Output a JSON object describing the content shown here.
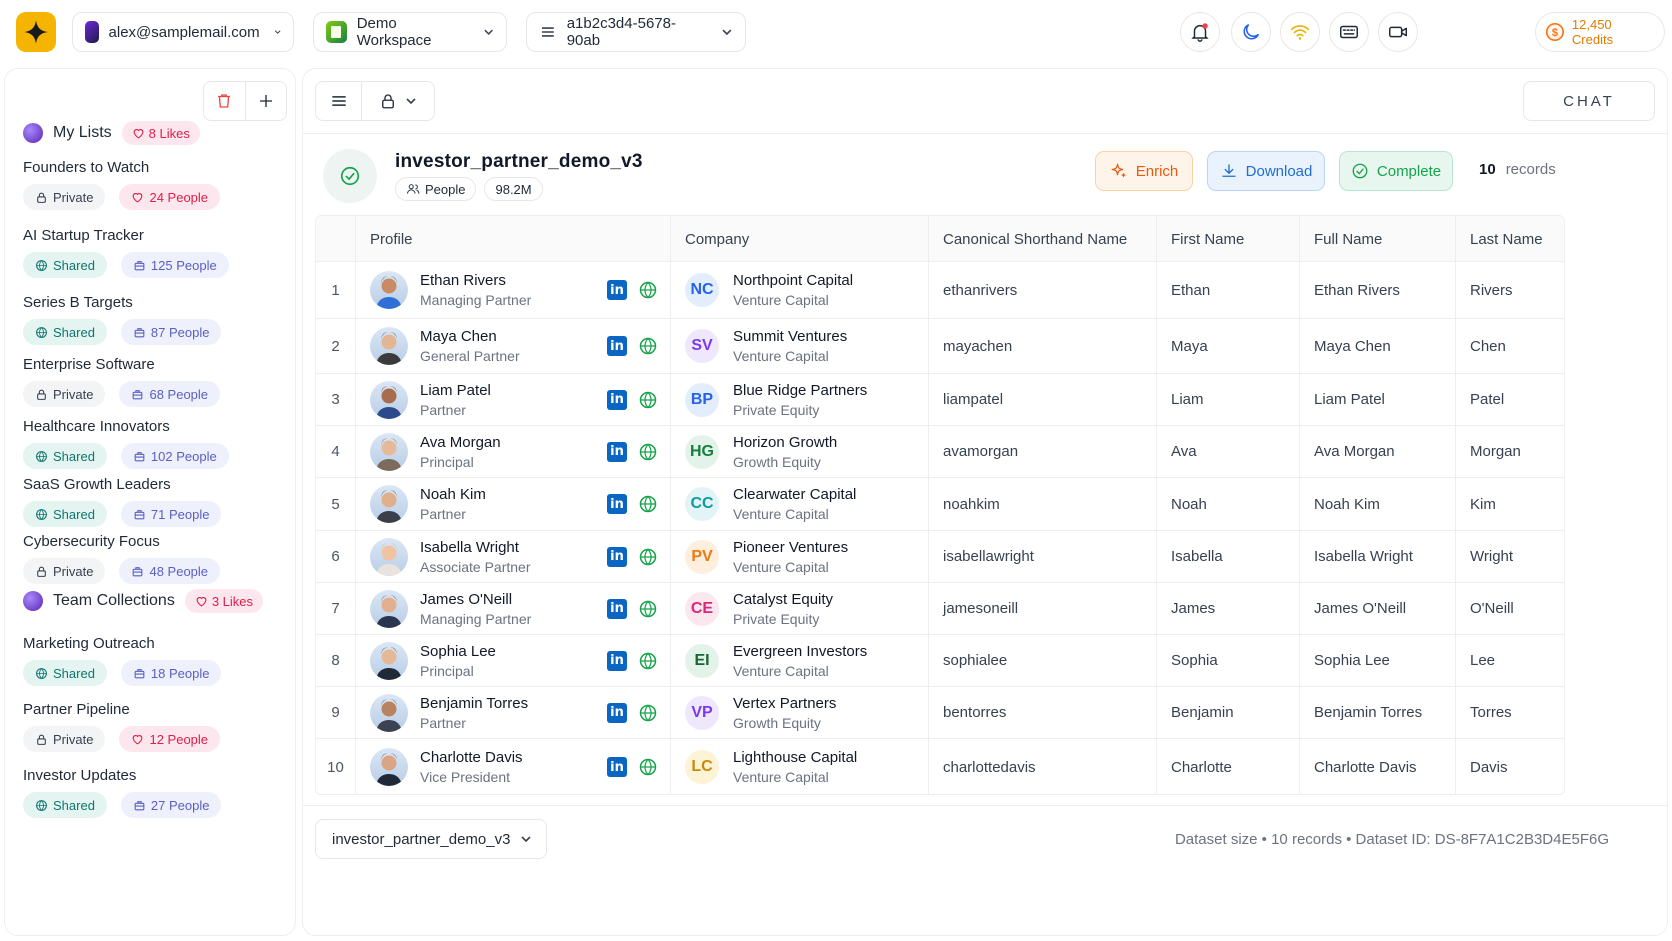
{
  "topbar": {
    "account": "alex@samplemail.com",
    "workspace": "Demo Workspace",
    "session_id": "a1b2c3d4-5678-90ab",
    "credits": "12,450 Credits"
  },
  "sidebar": {
    "groups": [
      {
        "name": "My Lists",
        "likes": "8 Likes",
        "items": [
          {
            "name": "Founders to Watch",
            "visibility": "Private",
            "people": "24 People",
            "people_style": "pink"
          },
          {
            "name": "AI Startup Tracker",
            "visibility": "Shared",
            "people": "125 People",
            "people_style": "blue"
          },
          {
            "name": "Series B Targets",
            "visibility": "Shared",
            "people": "87 People",
            "people_style": "blue"
          },
          {
            "name": "Enterprise Software",
            "visibility": "Private",
            "people": "68 People",
            "people_style": "blue"
          },
          {
            "name": "Healthcare Innovators",
            "visibility": "Shared",
            "people": "102 People",
            "people_style": "blue"
          },
          {
            "name": "SaaS Growth Leaders",
            "visibility": "Shared",
            "people": "71 People",
            "people_style": "blue"
          },
          {
            "name": "Cybersecurity Focus",
            "visibility": "Private",
            "people": "48 People",
            "people_style": "blue"
          }
        ]
      },
      {
        "name": "Team Collections",
        "likes": "3 Likes",
        "items": [
          {
            "name": "Marketing Outreach",
            "visibility": "Shared",
            "people": "18 People",
            "people_style": "blue"
          },
          {
            "name": "Partner Pipeline",
            "visibility": "Private",
            "people": "12 People",
            "people_style": "pink"
          },
          {
            "name": "Investor Updates",
            "visibility": "Shared",
            "people": "27 People",
            "people_style": "blue"
          }
        ]
      }
    ]
  },
  "main": {
    "chat_label": "CHAT",
    "dataset": {
      "title": "investor_partner_demo_v3",
      "type_chip": "People",
      "size_chip": "98.2M"
    },
    "actions": {
      "enrich": "Enrich",
      "download": "Download",
      "complete": "Complete"
    },
    "records": {
      "count": "10",
      "label": "records"
    },
    "table": {
      "columns": [
        "Profile",
        "Company",
        "Canonical Shorthand Name",
        "First Name",
        "Full Name",
        "Last Name"
      ],
      "rows": [
        {
          "n": "1",
          "name": "Ethan Rivers",
          "title": "Managing Partner",
          "company": "Northpoint Capital",
          "company_type": "Venture Capital",
          "initials": "NC",
          "handle": "ethanrivers",
          "first": "Ethan",
          "full": "Ethan Rivers",
          "last": "Rivers",
          "badge_bg": "#e3edfb",
          "badge_fg": "#2563eb",
          "skin": "#c98a64",
          "hair": "#2b1d15",
          "shirt": "#2f6fd6"
        },
        {
          "n": "2",
          "name": "Maya Chen",
          "title": "General Partner",
          "company": "Summit Ventures",
          "company_type": "Venture Capital",
          "initials": "SV",
          "handle": "mayachen",
          "first": "Maya",
          "full": "Maya Chen",
          "last": "Chen",
          "badge_bg": "#efe7fb",
          "badge_fg": "#7c3aed",
          "skin": "#e2b594",
          "hair": "#1a1412",
          "shirt": "#3b3b3b"
        },
        {
          "n": "3",
          "name": "Liam Patel",
          "title": "Partner",
          "company": "Blue Ridge Partners",
          "company_type": "Private Equity",
          "initials": "BP",
          "handle": "liampatel",
          "first": "Liam",
          "full": "Liam Patel",
          "last": "Patel",
          "badge_bg": "#e3edfb",
          "badge_fg": "#2563eb",
          "skin": "#a86e4c",
          "hair": "#1e1510",
          "shirt": "#2d4a8a"
        },
        {
          "n": "4",
          "name": "Ava Morgan",
          "title": "Principal",
          "company": "Horizon Growth",
          "company_type": "Growth Equity",
          "initials": "HG",
          "handle": "avamorgan",
          "first": "Ava",
          "full": "Ava Morgan",
          "last": "Morgan",
          "badge_bg": "#e4f3e9",
          "badge_fg": "#15803d",
          "skin": "#e6b99a",
          "hair": "#5a3a22",
          "shirt": "#7c6a5a"
        },
        {
          "n": "5",
          "name": "Noah Kim",
          "title": "Partner",
          "company": "Clearwater Capital",
          "company_type": "Venture Capital",
          "initials": "CC",
          "handle": "noahkim",
          "first": "Noah",
          "full": "Noah Kim",
          "last": "Kim",
          "badge_bg": "#e2f4f6",
          "badge_fg": "#0e9aa7",
          "skin": "#e0b08c",
          "hair": "#1b1b1b",
          "shirt": "#3a3f4a"
        },
        {
          "n": "6",
          "name": "Isabella Wright",
          "title": "Associate Partner",
          "company": "Pioneer Ventures",
          "company_type": "Venture Capital",
          "initials": "PV",
          "handle": "isabellawright",
          "first": "Isabella",
          "full": "Isabella Wright",
          "last": "Wright",
          "badge_bg": "#fdeede",
          "badge_fg": "#ea7a12",
          "skin": "#f0c4a2",
          "hair": "#d9a24a",
          "shirt": "#e8e3dc"
        },
        {
          "n": "7",
          "name": "James O'Neill",
          "title": "Managing Partner",
          "company": "Catalyst Equity",
          "company_type": "Private Equity",
          "initials": "CE",
          "handle": "jamesoneill",
          "first": "James",
          "full": "James O'Neill",
          "last": "O'Neill",
          "badge_bg": "#fde7ee",
          "badge_fg": "#db2777",
          "skin": "#e2b08e",
          "hair": "#3a2a1e",
          "shirt": "#2a3550"
        },
        {
          "n": "8",
          "name": "Sophia Lee",
          "title": "Principal",
          "company": "Evergreen Investors",
          "company_type": "Venture Capital",
          "initials": "EI",
          "handle": "sophialee",
          "first": "Sophia",
          "full": "Sophia Lee",
          "last": "Lee",
          "badge_bg": "#e4f3e9",
          "badge_fg": "#166534",
          "skin": "#e6b996",
          "hair": "#1c1512",
          "shirt": "#1f2937"
        },
        {
          "n": "9",
          "name": "Benjamin Torres",
          "title": "Partner",
          "company": "Vertex Partners",
          "company_type": "Growth Equity",
          "initials": "VP",
          "handle": "bentorres",
          "first": "Benjamin",
          "full": "Benjamin Torres",
          "last": "Torres",
          "badge_bg": "#efe7fb",
          "badge_fg": "#7c3aed",
          "skin": "#b98360",
          "hair": "#2a1f18",
          "shirt": "#3b4252"
        },
        {
          "n": "10",
          "name": "Charlotte Davis",
          "title": "Vice President",
          "company": "Lighthouse Capital",
          "company_type": "Venture Capital",
          "initials": "LC",
          "handle": "charlottedavis",
          "first": "Charlotte",
          "full": "Charlotte Davis",
          "last": "Davis",
          "badge_bg": "#fdf3d6",
          "badge_fg": "#c98a06",
          "skin": "#d9a582",
          "hair": "#3b2416",
          "shirt": "#1f2937"
        }
      ]
    },
    "footer": {
      "dataset_select": "investor_partner_demo_v3",
      "status": "Dataset size • 10 records • Dataset ID: DS-8F7A1C2B3D4E5F6G"
    }
  },
  "colors": {
    "accent": "#f5b400",
    "linkedin": "#0a66c2",
    "web": "#16a34a",
    "likes": "#e11d48"
  }
}
